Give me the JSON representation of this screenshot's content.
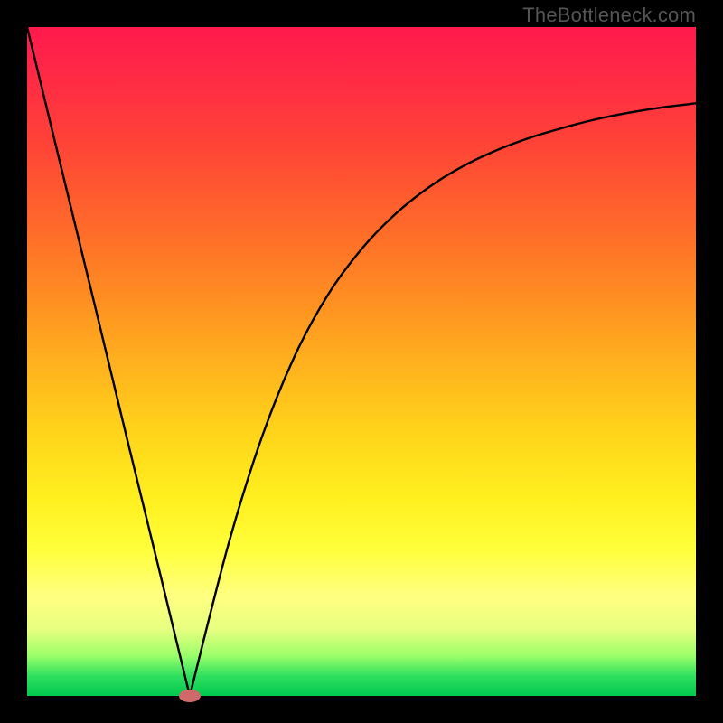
{
  "watermark": "TheBottleneck.com",
  "chart_data": {
    "type": "line",
    "title": "",
    "xlabel": "",
    "ylabel": "",
    "xlim": [
      0,
      1
    ],
    "ylim": [
      0,
      1
    ],
    "grid": false,
    "legend": false,
    "background": "red-to-green vertical gradient",
    "series": [
      {
        "name": "bottleneck-curve",
        "color": "#000000",
        "x": [
          0.0,
          0.05,
          0.1,
          0.15,
          0.2,
          0.2432,
          0.3,
          0.35,
          0.4,
          0.45,
          0.5,
          0.55,
          0.6,
          0.65,
          0.7,
          0.75,
          0.8,
          0.85,
          0.9,
          0.95,
          1.0
        ],
        "y": [
          1.0,
          0.794,
          0.589,
          0.382,
          0.178,
          0.0,
          0.223,
          0.384,
          0.508,
          0.6,
          0.668,
          0.72,
          0.76,
          0.791,
          0.815,
          0.834,
          0.849,
          0.862,
          0.872,
          0.88,
          0.886
        ]
      }
    ],
    "marker": {
      "name": "minimum-point",
      "x": 0.2432,
      "y": 0.0,
      "color": "#d06a6a",
      "rx": 12,
      "ry": 7
    }
  }
}
